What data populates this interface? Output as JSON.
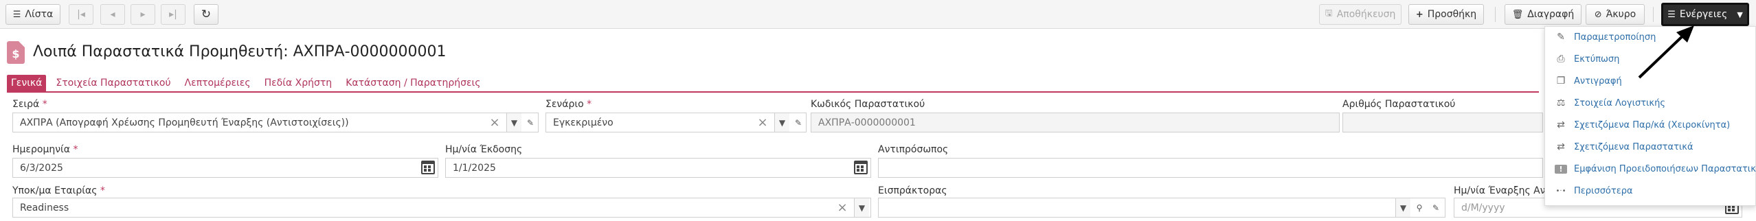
{
  "toolbar": {
    "list_label": "Λίστα",
    "save_label": "Αποθήκευση",
    "add_label": "Προσθήκη",
    "delete_label": "Διαγραφή",
    "cancel_label": "Άκυρο",
    "actions_label": "Ενέργειες"
  },
  "header": {
    "icon_glyph": "$",
    "title": "Λοιπά Παραστατικά Προμηθευτή: ΑΧΠΡΑ-0000000001"
  },
  "tabs": [
    {
      "label": "Γενικά",
      "active": true
    },
    {
      "label": "Στοιχεία Παραστατικού",
      "active": false
    },
    {
      "label": "Λεπτομέρειες",
      "active": false
    },
    {
      "label": "Πεδία Χρήστη",
      "active": false
    },
    {
      "label": "Κατάσταση / Παρατηρήσεις",
      "active": false
    }
  ],
  "fields": {
    "series": {
      "label": "Σειρά",
      "value": "ΑΧΠΡΑ (Απογραφή Χρέωσης Προμηθευτή Έναρξης (Αντιστοιχίσεις))"
    },
    "scenario": {
      "label": "Σενάριο",
      "value": "Εγκεκριμένο"
    },
    "doc_code": {
      "label": "Κωδικός Παραστατικού",
      "value": "ΑΧΠΡΑ-0000000001"
    },
    "doc_number": {
      "label": "Αριθμός Παραστατικού",
      "value": ""
    },
    "date": {
      "label": "Ημερομηνία",
      "value": "6/3/2025"
    },
    "issue_date": {
      "label": "Ημ/νία Έκδοσης",
      "value": "1/1/2025"
    },
    "representative": {
      "label": "Αντιπρόσωπος",
      "value": ""
    },
    "branch": {
      "label": "Υποκ/μα Εταιρίας",
      "value": "Readiness"
    },
    "collector": {
      "label": "Εισπράκτορας",
      "value": ""
    },
    "start_date": {
      "label": "Ημ/νία Έναρξης Αντ",
      "placeholder": "d/M/yyyy"
    }
  },
  "required_mark": "*",
  "menu": {
    "items": [
      {
        "label": "Παραμετροποίηση",
        "icon": "edit-icon",
        "glyph": "✎"
      },
      {
        "label": "Εκτύπωση",
        "icon": "printer-icon",
        "glyph": "⎙"
      },
      {
        "label": "Αντιγραφή",
        "icon": "copy-icon",
        "glyph": "❐"
      },
      {
        "label": "Στοιχεία Λογιστικής",
        "icon": "accounting-icon",
        "glyph": "⚖"
      },
      {
        "label": "Σχετιζόμενα Παρ/κά (Χειροκίνητα)",
        "icon": "related-manual-icon",
        "glyph": "⇄"
      },
      {
        "label": "Σχετιζόμενα Παραστατικά",
        "icon": "related-docs-icon",
        "glyph": "⇄"
      },
      {
        "label": "Εμφάνιση Προειδοποιήσεων Παραστατικού",
        "icon": "warning-icon",
        "glyph": "!"
      },
      {
        "label": "Περισσότερα",
        "icon": "more-icon",
        "glyph": "•·•"
      }
    ]
  },
  "colors": {
    "accent": "#c0395f",
    "link": "#2d6ea8"
  }
}
